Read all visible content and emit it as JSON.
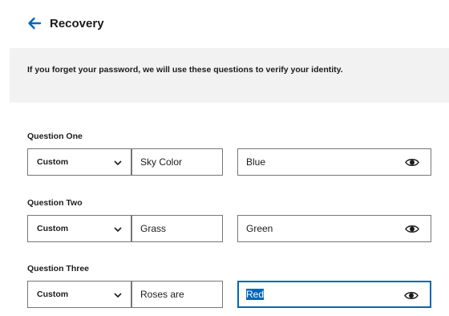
{
  "header": {
    "title": "Recovery",
    "back_icon": "arrow-left-icon",
    "accent_color": "#0067b8"
  },
  "banner": {
    "text": "If you forget your password, we will use these questions to verify your identity."
  },
  "questions": [
    {
      "label": "Question One",
      "type": "Custom",
      "question": "Sky Color",
      "answer": "Blue"
    },
    {
      "label": "Question Two",
      "type": "Custom",
      "question": "Grass",
      "answer": "Green"
    },
    {
      "label": "Question Three",
      "type": "Custom",
      "question": "Roses are",
      "answer": "Red",
      "answer_selected": true
    }
  ],
  "icons": {
    "chevron": "chevron-down-icon",
    "reveal": "eye-icon"
  }
}
